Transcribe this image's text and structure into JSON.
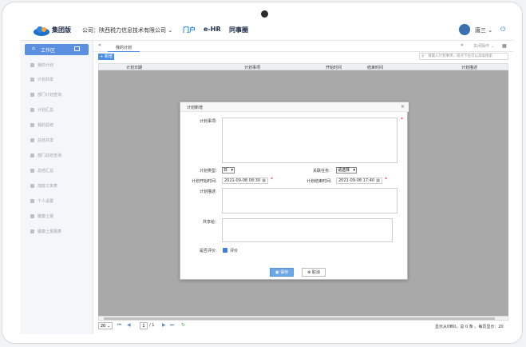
{
  "header": {
    "app_title": "集团版",
    "company_prefix": "公司：",
    "company_name": "陕西税力信息技术有限公司",
    "nav": [
      "门户",
      "e-HR",
      "同事圈"
    ],
    "user_name": "唐三"
  },
  "sidebar": {
    "active": "工作区",
    "items": [
      "我的计划",
      "计划共享",
      "部门计划查询",
      "计划汇总",
      "我的总结",
      "总结共享",
      "部门总结查询",
      "总结汇总",
      "加班工资表",
      "个人设置",
      "键康上报",
      "键康上报报表"
    ]
  },
  "tabs": {
    "current": "我的计划",
    "close_ops": "关闭操作"
  },
  "toolbar": {
    "add_label": "+ 新增",
    "search_placeholder": "请输入计划事项、或点下拉可以高级搜索"
  },
  "table": {
    "columns": [
      "计划日期",
      "计划事项",
      "开始时间",
      "结束时间",
      "计划描述"
    ]
  },
  "pager": {
    "page_size": "20",
    "page_input": "1",
    "page_total": "/ 1",
    "info": "显示从0到0，总 0 条 。每页显示：20"
  },
  "dialog": {
    "title": "计划新增",
    "labels": {
      "plan_item": "计划事项:",
      "plan_type": "计划类型:",
      "related_task": "关联任务:",
      "start_time": "计划开始时间:",
      "end_time": "计划结束时间:",
      "description": "计划描述:",
      "share_to": "共享给：",
      "evaluate": "是否评价:"
    },
    "plan_type_value": "日",
    "related_task_value": "请选择",
    "start_value": "2021-09-08 08:30",
    "end_value": "2021-09-08 17:40",
    "evaluate_checkbox_label": "评价",
    "save_label": "保存",
    "cancel_label": "取消"
  },
  "colors": {
    "accent": "#4a90e2",
    "sidebar_active": "#5b8fe0",
    "grid_bg": "#a9a9a9",
    "required": "#e02020"
  }
}
